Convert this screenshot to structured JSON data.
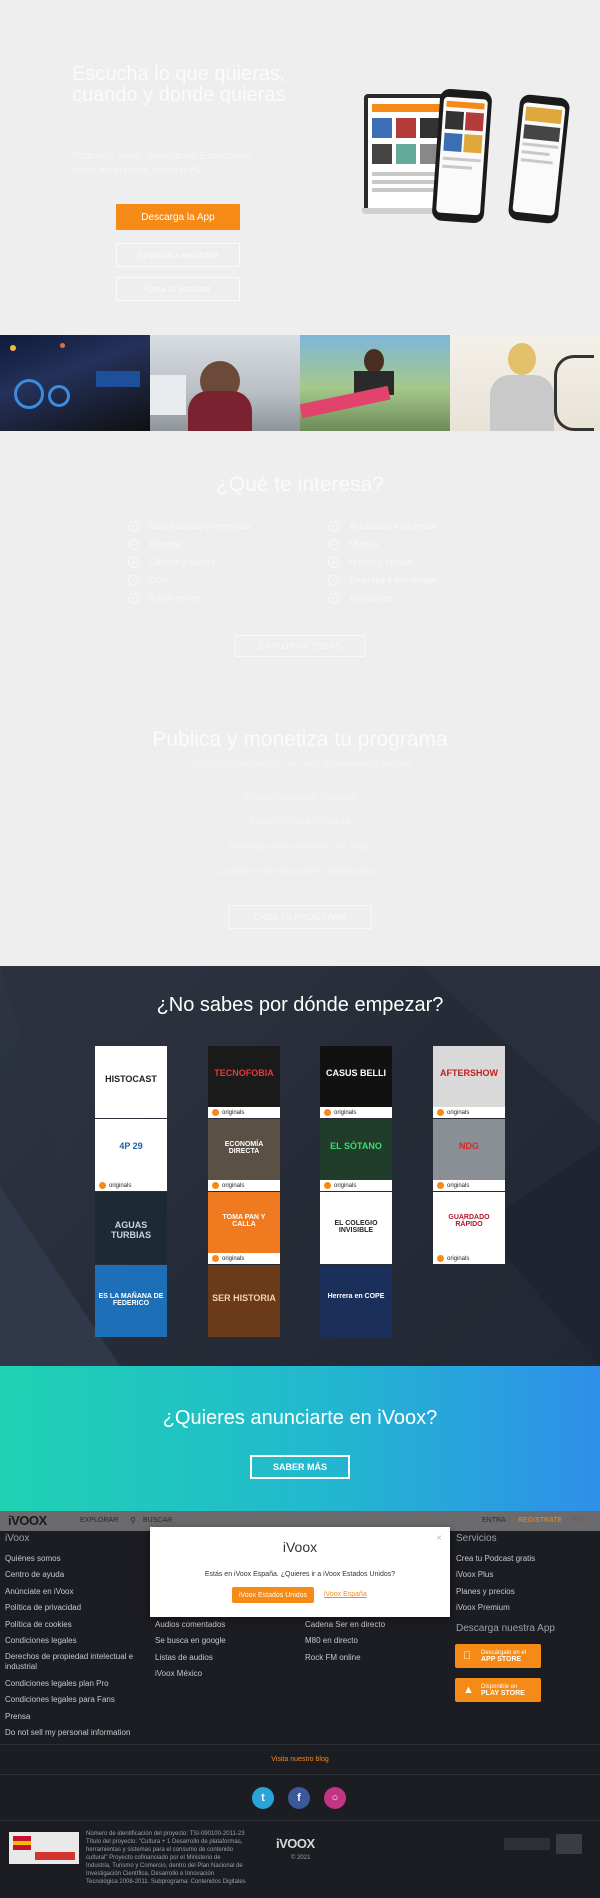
{
  "hero": {
    "title": "Escucha lo que quieras, cuando y donde quieras",
    "subtitle": "Podcasts, radio, audiolibros. Escúchalos gratis en tu móvil, tablet o PC.",
    "app_button": "Descarga la App",
    "explore_button": "Empieza a escuchar",
    "free_button": "Crea tu podcast"
  },
  "interests": {
    "title": "¿Qué te interesa?",
    "left": [
      "Espiritualidad y creencias",
      "Deporte",
      "Ciencia y cultura",
      "Ocio",
      "Radio online"
    ],
    "right": [
      "Actualidad y sociedad",
      "Música",
      "Humor y familia",
      "Empresa y tecnología",
      "Audiolibros"
    ],
    "explore_button": "EXPLORAR TODAS"
  },
  "publish": {
    "title": "Publica y monetiza tu programa",
    "subtitle": "Crea tu programa de audio en iVoox, la plataforma de podcast",
    "items": [
      "Almacenamiento ilimitado",
      "Transferencia ilimitada",
      "Monetiza con contenido de pago",
      "Cuantos más escuchen, mejor para ti"
    ],
    "button": "CREA TU PROGRAMA"
  },
  "start": {
    "title": "¿No sabes por dónde empezar?",
    "tiles": [
      {
        "label": "HISTOCAST",
        "bg": "#ffffff",
        "fg": "#222222",
        "original": false
      },
      {
        "label": "TECNOFOBIA",
        "bg": "#1a1a1a",
        "fg": "#e33a3a",
        "original": true
      },
      {
        "label": "CASUS BELLI",
        "bg": "#111111",
        "fg": "#ffffff",
        "original": true
      },
      {
        "label": "AFTERSHOW",
        "bg": "#d9d9d9",
        "fg": "#c21e1e",
        "original": true
      },
      {
        "label": "4P 29",
        "bg": "#ffffff",
        "fg": "#1f5ea8",
        "original": true
      },
      {
        "label": "ECONOMÍA DIRECTA",
        "bg": "#5a5044",
        "fg": "#ffffff",
        "original": true
      },
      {
        "label": "EL SÓTANO",
        "bg": "#1f3d2a",
        "fg": "#3ddc6a",
        "original": true
      },
      {
        "label": "NDG",
        "bg": "#8a8f96",
        "fg": "#d12b2b",
        "original": true
      },
      {
        "label": "AGUAS TURBIAS",
        "bg": "#1e2a33",
        "fg": "#c9d4dd",
        "original": false
      },
      {
        "label": "TOMA PAN Y CALLA",
        "bg": "#f07a1f",
        "fg": "#ffffff",
        "original": true
      },
      {
        "label": "EL COLEGIO INVISIBLE",
        "bg": "#ffffff",
        "fg": "#222222",
        "original": false
      },
      {
        "label": "GUARDADO RÁPIDO",
        "bg": "#ffffff",
        "fg": "#b0162c",
        "original": true
      },
      {
        "label": "ES LA MAÑANA DE FEDERICO",
        "bg": "#1d6fb8",
        "fg": "#ffffff",
        "original": false
      },
      {
        "label": "SER HISTORIA",
        "bg": "#6b3a1a",
        "fg": "#f2d7a6",
        "original": false
      },
      {
        "label": "Herrera en COPE",
        "bg": "#1a2f5a",
        "fg": "#ffffff",
        "original": false
      }
    ],
    "original_label": "originals"
  },
  "advertise": {
    "title": "¿Quieres anunciarte en iVoox?",
    "button": "SABER MÁS"
  },
  "topbar": {
    "logo": "iVOOX",
    "explore": "EXPLORAR",
    "search": "BUSCAR",
    "login": "ENTRA",
    "register": "REGISTRATE",
    "lang": "ES"
  },
  "footer": {
    "col1_title": "iVoox",
    "col1": [
      "Quiénes somos",
      "Centro de ayuda",
      "Anúnciate en iVoox",
      "Política de privacidad",
      "Política de cookies",
      "Condiciones legales",
      "Derechos de propiedad intelectual e industrial",
      "Condiciones legales plan Pro",
      "Condiciones legales para Fans",
      "Prensa",
      "Do not sell my personal information"
    ],
    "col2": [
      "Audios comentados",
      "Se busca en google",
      "Listas de audios",
      "iVoox México"
    ],
    "col3": [
      "Cadena Ser en directo",
      "M80 en directo",
      "Rock FM online"
    ],
    "col4_title": "Servicios",
    "col4": [
      "Crea tu Podcast gratis",
      "iVoox Plus",
      "Planes y precios",
      "iVoox Premium"
    ],
    "download_title": "Descarga nuestra App",
    "appstore_small": "Descárgalo en el",
    "appstore": "APP STORE",
    "playstore_small": "Disponible en",
    "playstore": "PLAY STORE",
    "blog": "Visita nuestro blog",
    "logo": "iVOOX",
    "copyright": "© 2021",
    "legal_text": "Número de identificación del proyecto: TSI-090100-2011-23 Título del proyecto: \"Cultura + 1 Desarrollo de plataformas, herramientas y sistemas para el consumo de contenido cultural\" Proyecto cofinanciado por el Ministerio de Industria, Turismo y Comercio, dentro del Plan Nacional de Investigación Científica, Desarrollo e Innovación Tecnológica 2008-2011. Subprograma: Contenidos Digitales"
  },
  "modal": {
    "title": "iVoox",
    "question": "Estás en iVoox España. ¿Quieres ir a iVoox Estados Unidos?",
    "primary": "iVoox Estados Unidos",
    "secondary": "iVoox España",
    "close": "×"
  },
  "colors": {
    "accent": "#f68a16",
    "hero_bg": "#eeeeef",
    "dark_bg": "#262c37",
    "footer_bg": "#1c1d22"
  }
}
